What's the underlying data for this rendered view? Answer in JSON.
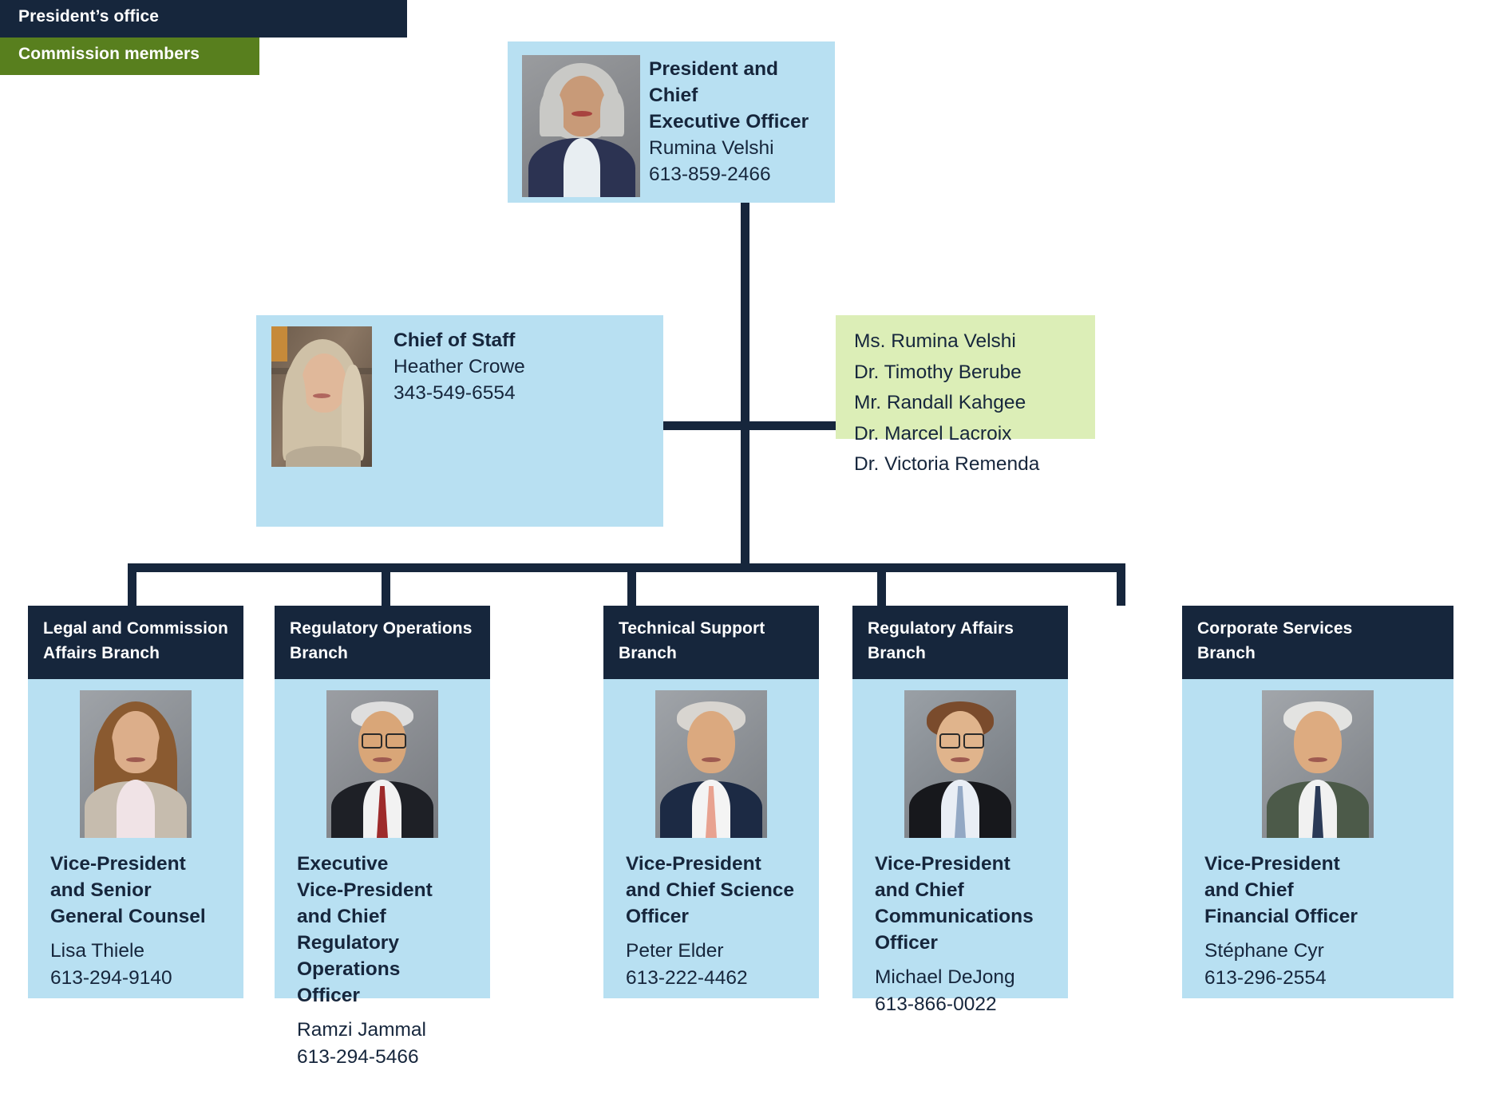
{
  "ceo": {
    "role": "President and Chief Executive Officer",
    "role_line1": "President and Chief",
    "role_line2": "Executive Officer",
    "name": "Rumina Velshi",
    "phone": "613-859-2466",
    "photo_alt": "portrait-rumina-velshi"
  },
  "presidents_office": {
    "header": "President’s office",
    "role": "Chief of Staff",
    "name": "Heather Crowe",
    "phone": "343-549-6554",
    "photo_alt": "portrait-heather-crowe"
  },
  "commission": {
    "header": "Commission members",
    "members": [
      "Ms. Rumina Velshi",
      "Dr. Timothy Berube",
      "Mr. Randall Kahgee",
      "Dr. Marcel Lacroix",
      "Dr. Victoria Remenda"
    ]
  },
  "branches": [
    {
      "header_line1": "Legal and Commission",
      "header_line2": "Affairs Branch",
      "role_lines": [
        "Vice-President",
        "and Senior",
        "General Counsel"
      ],
      "name": "Lisa Thiele",
      "phone": "613-294-9140",
      "photo_alt": "portrait-lisa-thiele"
    },
    {
      "header_line1": "Regulatory Operations",
      "header_line2": "Branch",
      "role_lines": [
        "Executive",
        "Vice-President",
        "and Chief Regulatory",
        "Operations Officer"
      ],
      "name": "Ramzi Jammal",
      "phone": "613-294-5466",
      "photo_alt": "portrait-ramzi-jammal"
    },
    {
      "header_line1": "Technical Support",
      "header_line2": "Branch",
      "role_lines": [
        "Vice-President",
        "and Chief Science",
        "Officer"
      ],
      "name": "Peter Elder",
      "phone": "613-222-4462",
      "photo_alt": "portrait-peter-elder"
    },
    {
      "header_line1": "Regulatory Affairs",
      "header_line2": "Branch",
      "role_lines": [
        "Vice-President",
        "and Chief",
        "Communications",
        "Officer"
      ],
      "name": "Michael DeJong",
      "phone": "613-866-0022",
      "photo_alt": "portrait-michael-dejong"
    },
    {
      "header_line1": "Corporate Services",
      "header_line2": "Branch",
      "role_lines": [
        "Vice-President",
        "and Chief",
        "Financial Officer"
      ],
      "name": "Stéphane Cyr",
      "phone": "613-296-2554",
      "photo_alt": "portrait-stephane-cyr"
    }
  ],
  "colors": {
    "dark_navy": "#16263c",
    "light_blue": "#b8e0f2",
    "green_header": "#587f1e",
    "light_green": "#dceeb7",
    "white": "#ffffff"
  }
}
